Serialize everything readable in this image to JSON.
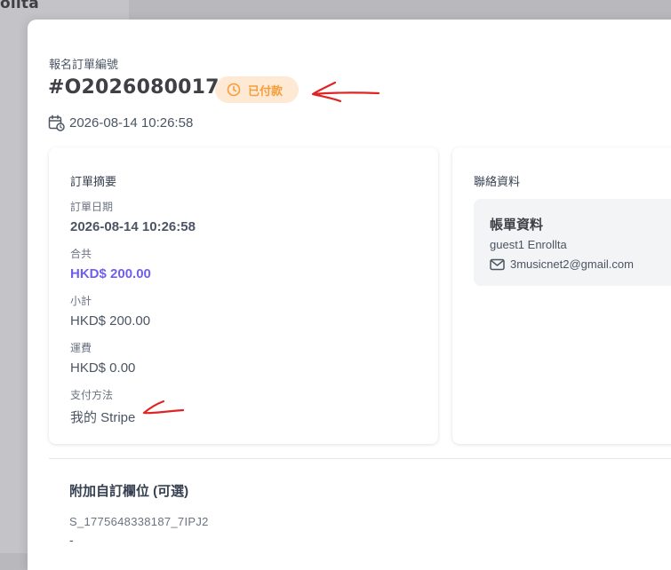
{
  "background": {
    "brand_fragment": "ollta"
  },
  "order": {
    "label": "報名訂單編號",
    "number": "#O2026080017",
    "status": "已付款",
    "date": "2026-08-14 10:26:58"
  },
  "summary": {
    "title": "訂單摘要",
    "fields": [
      {
        "label": "訂單日期",
        "value": "2026-08-14 10:26:58"
      },
      {
        "label": "合共",
        "value": "HKD$ 200.00"
      },
      {
        "label": "小計",
        "value": "HKD$ 200.00"
      },
      {
        "label": "運費",
        "value": "HKD$ 0.00"
      },
      {
        "label": "支付方法",
        "value": "我的 Stripe"
      }
    ]
  },
  "contact": {
    "title": "聯絡資料",
    "billing": {
      "title": "帳單資料",
      "name": "guest1 Enrollta",
      "email": "3musicnet2@gmail.com"
    }
  },
  "custom_fields": {
    "title": "附加自訂欄位 (可選)",
    "key": "S_1775648338187_7IPJ2",
    "value": "-"
  },
  "colors": {
    "status_bg": "#fde9d4",
    "status_text": "#f59e3b",
    "accent": "#6f5ff0",
    "annotation": "#e02424"
  },
  "icons": {
    "status": "clock-icon",
    "date": "calendar-clock-icon",
    "email": "mail-icon"
  }
}
